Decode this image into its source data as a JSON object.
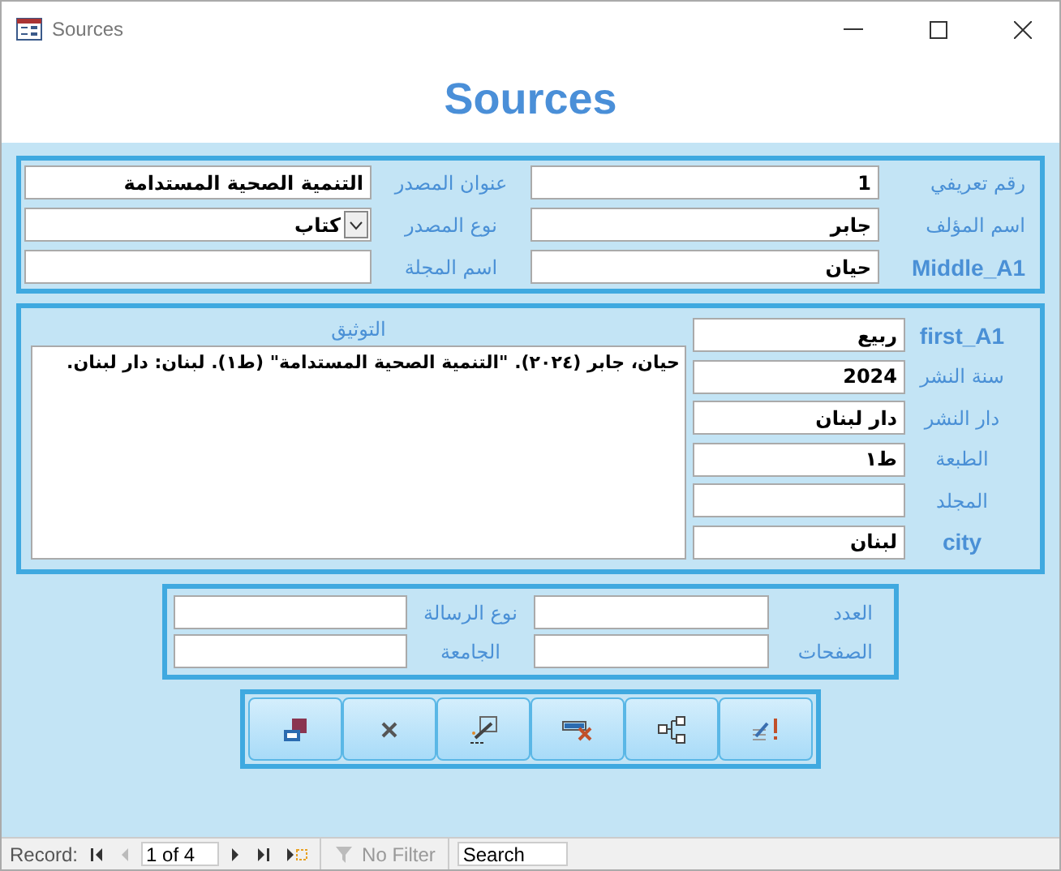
{
  "window": {
    "title": "Sources"
  },
  "heading": "Sources",
  "section_1": {
    "rows": [
      {
        "label_a": "رقم تعريفي",
        "field_a": {
          "value": "1"
        },
        "label_b": "عنوان المصدر",
        "field_b": {
          "value": "التنمية الصحية المستدامة",
          "kind": "text"
        }
      },
      {
        "label_a": "اسم المؤلف",
        "field_a": {
          "value": "جابر"
        },
        "label_b": "نوع المصدر",
        "field_b": {
          "value": "كتاب",
          "kind": "combo"
        }
      },
      {
        "label_a": "Middle_A1",
        "field_a": {
          "value": "حيان"
        },
        "label_b": "اسم المجلة",
        "field_b": {
          "kind": "text"
        }
      }
    ]
  },
  "section_2": {
    "fields": [
      {
        "label": "first_A1",
        "value": "ربيع"
      },
      {
        "label": "سنة النشر",
        "value": "2024"
      },
      {
        "label": "دار النشر",
        "value": "دار لبنان"
      },
      {
        "label": "الطبعة",
        "value": "ط١"
      },
      {
        "label": "المجلد"
      },
      {
        "label": "city",
        "value": "لبنان"
      }
    ],
    "citation": {
      "label": "التوثيق",
      "value": "حيان، جابر (٢٠٢٤). \"التنمية الصحية المستدامة\" (ط١). لبنان: دار لبنان."
    }
  },
  "section_3": {
    "rows": [
      {
        "label_a": "العدد",
        "label_b": "نوع الرسالة"
      },
      {
        "label_a": "الصفحات",
        "label_b": "الجامعة"
      }
    ]
  },
  "buttons": [
    {
      "kind": "save"
    },
    {
      "kind": "close"
    },
    {
      "kind": "wand"
    },
    {
      "kind": "delete"
    },
    {
      "kind": "tree"
    },
    {
      "kind": "edit"
    }
  ],
  "status_bar": {
    "label": "Record:",
    "nav": [
      {
        "kind": "first",
        "disabled": false
      },
      {
        "kind": "prev",
        "disabled": true
      }
    ],
    "position": "1 of 4",
    "nav_after": [
      {
        "kind": "next",
        "disabled": false
      },
      {
        "kind": "last",
        "disabled": false
      },
      {
        "kind": "new",
        "disabled": false
      }
    ],
    "filter": {
      "label": "No Filter",
      "disabled": true
    },
    "search": {
      "placeholder": "Search"
    }
  }
}
